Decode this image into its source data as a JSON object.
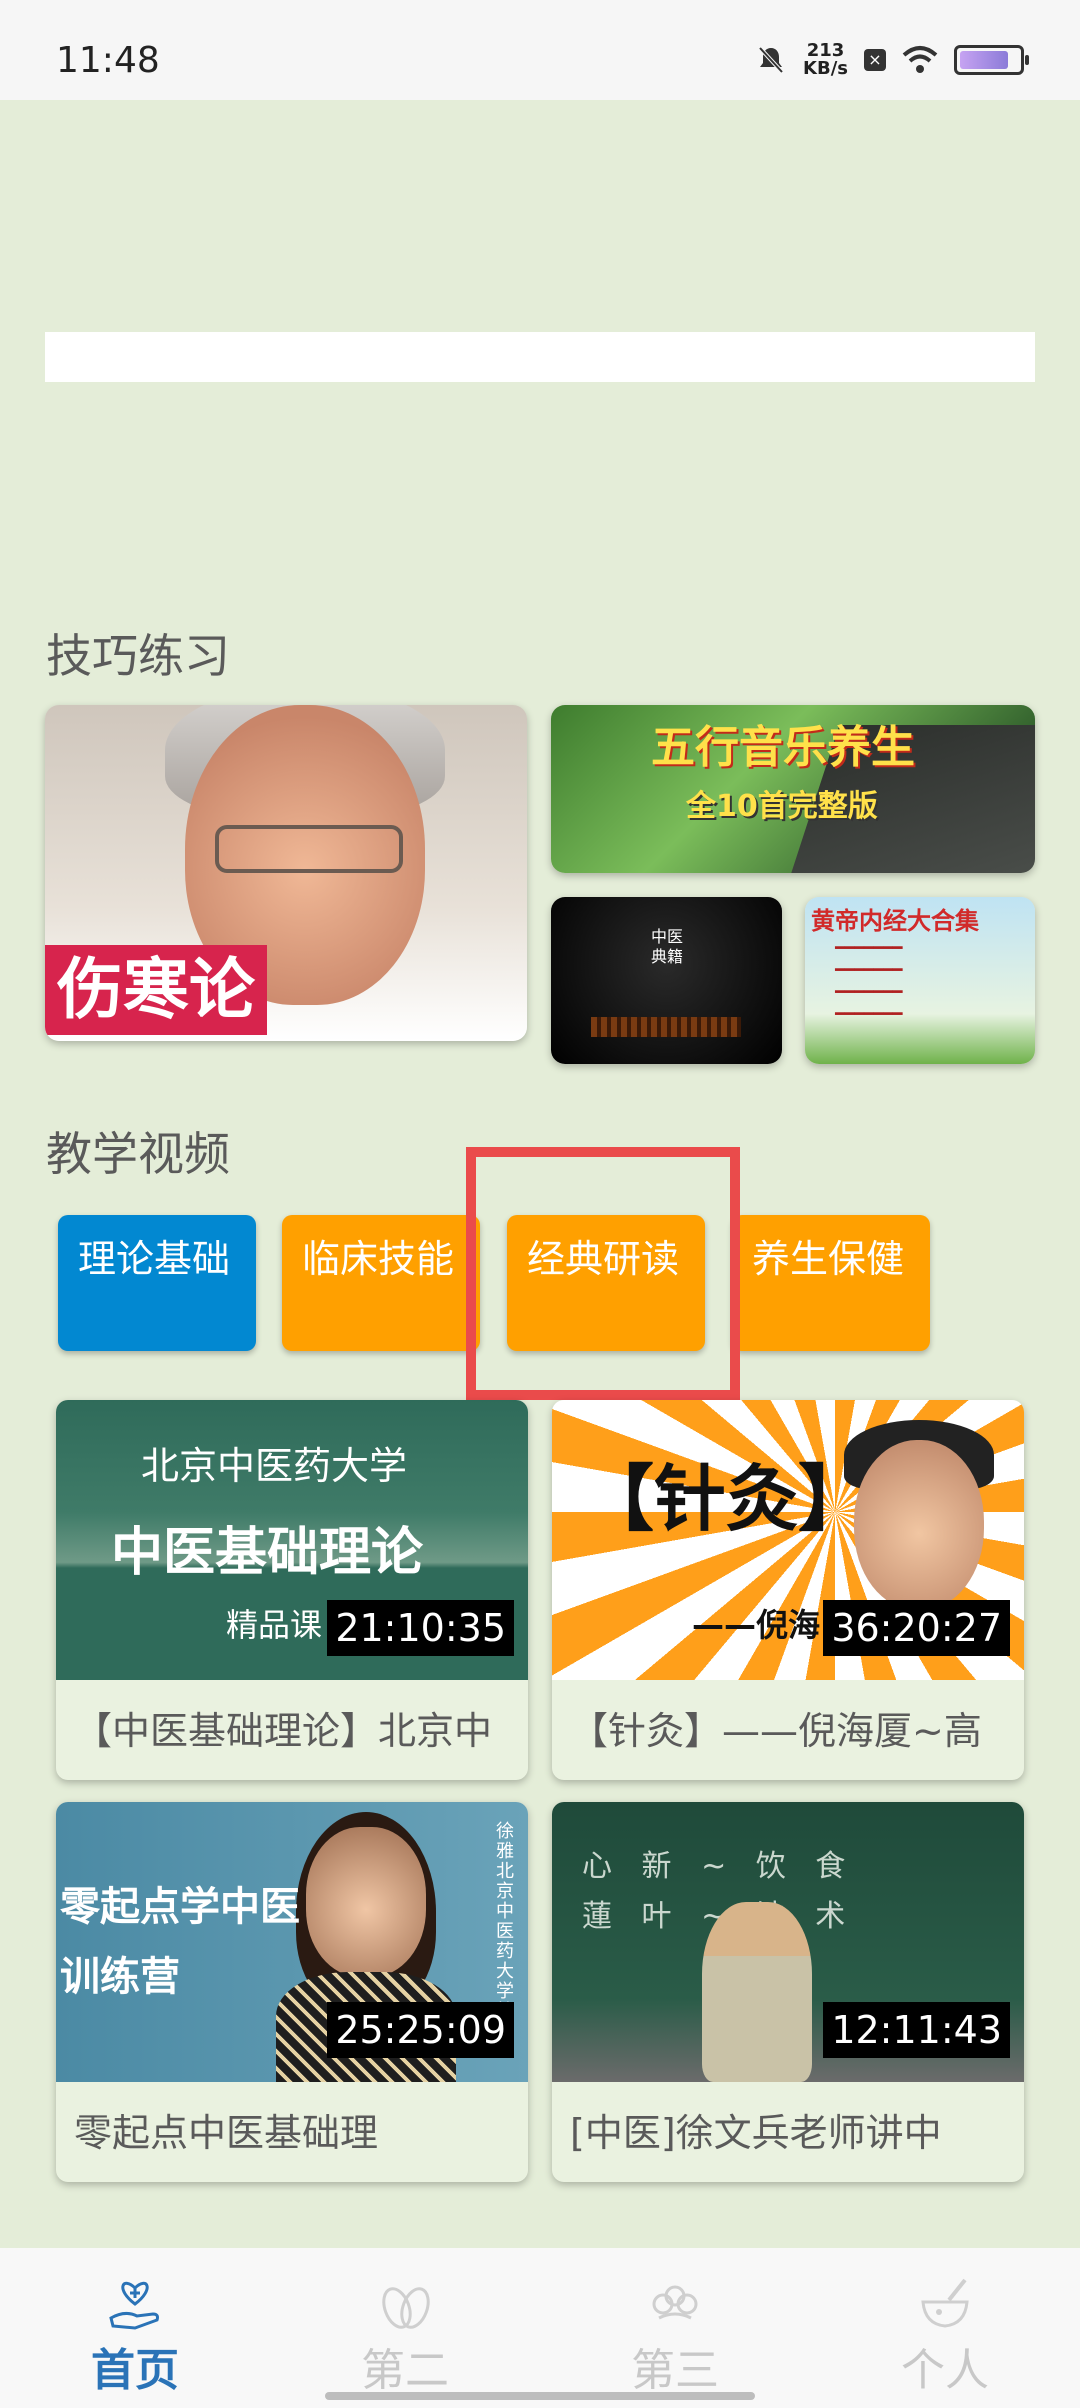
{
  "status": {
    "time": "11:48",
    "speed_value": "213",
    "speed_unit": "KB/s"
  },
  "sections": {
    "skills": "技巧练习",
    "teaching": "教学视频"
  },
  "featured": {
    "portrait_caption": "伤寒论",
    "music_title": "五行音乐养生",
    "music_subtitle": "全10首完整版",
    "book_title": "黄帝内经大合集"
  },
  "categories": [
    {
      "label": "理论基础",
      "color": "#0288d1"
    },
    {
      "label": "临床技能",
      "color": "#ffa000"
    },
    {
      "label": "经典研读",
      "color": "#ffa000"
    },
    {
      "label": "养生保健",
      "color": "#ffa000"
    }
  ],
  "videos": [
    {
      "title": "【中医基础理论】北京中",
      "duration": "21:10:35",
      "thumb_line1": "北京中医药大学",
      "thumb_line2": "中医基础理论",
      "thumb_line3": "精品课"
    },
    {
      "title": "【针灸】——倪海厦~高",
      "duration": "36:20:27",
      "thumb_line1": "【针灸】",
      "thumb_line2": "——倪海"
    },
    {
      "title": "零起点中医基础理",
      "duration": "25:25:09",
      "thumb_line1": "零起点学中医",
      "thumb_line2": "训练营",
      "thumb_side": "徐雅 北京中医药大学教授"
    },
    {
      "title": "[中医]徐文兵老师讲中",
      "duration": "12:11:43"
    }
  ],
  "nav": [
    {
      "label": "首页",
      "icon": "heart-hand-icon",
      "active": true
    },
    {
      "label": "第二",
      "icon": "leaves-icon",
      "active": false
    },
    {
      "label": "第三",
      "icon": "flower-icon",
      "active": false
    },
    {
      "label": "个人",
      "icon": "mortar-icon",
      "active": false
    }
  ],
  "colors": {
    "background": "#e4edd8",
    "accent": "#2a73b7",
    "highlight": "#ea4b4b"
  }
}
